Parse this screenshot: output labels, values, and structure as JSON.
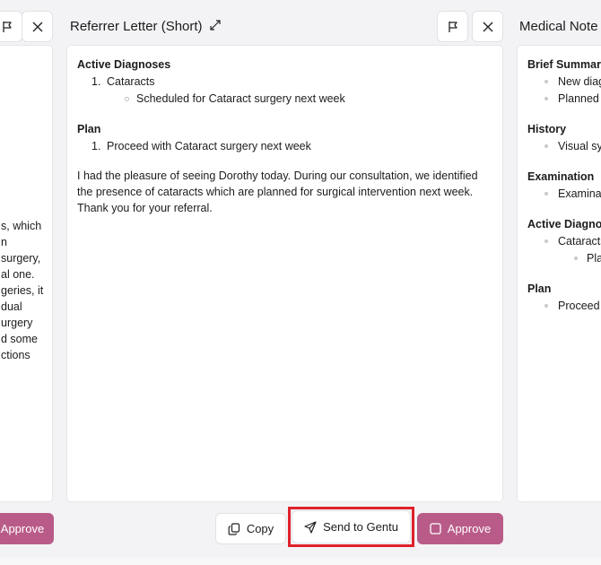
{
  "left_panel": {
    "partial_lines": [
      "s, which",
      "n",
      "surgery,",
      "al one.",
      "geries, it",
      "dual",
      "urgery",
      "d some",
      "ctions"
    ],
    "approve_label": "Approve"
  },
  "center_panel": {
    "title": "Referrer Letter (Short)",
    "sections": {
      "active_diagnoses": {
        "title": "Active Diagnoses",
        "item_number": "1.",
        "item": "Cataracts",
        "subitem": "Scheduled for Cataract surgery next week"
      },
      "plan": {
        "title": "Plan",
        "item_number": "1.",
        "item": "Proceed with Cataract surgery next week"
      }
    },
    "paragraph_lines": [
      "I had the pleasure of seeing Dorothy today. During our consultation, we identified",
      "the presence of cataracts which are planned for surgical intervention next week.",
      "Thank you for your referral."
    ],
    "buttons": {
      "copy": "Copy",
      "send": "Send to Gentu",
      "approve": "Approve"
    }
  },
  "right_panel": {
    "title": "Medical Note",
    "brief_summary": {
      "title": "Brief Summary",
      "items": [
        "New diag",
        "Planned c"
      ]
    },
    "history": {
      "title": "History",
      "items": [
        "Visual syr"
      ]
    },
    "examination": {
      "title": "Examination",
      "items": [
        "Examinati"
      ]
    },
    "active_diagnoses": {
      "title": "Active Diagnos",
      "item": "Cataracts",
      "subitem": "Pla"
    },
    "plan": {
      "title": "Plan",
      "items": [
        "Proceed w"
      ]
    }
  },
  "colors": {
    "approve_button": "#b95b88",
    "highlight": "#e0212b",
    "background": "#f3f3f5"
  },
  "icons": [
    "flag-icon",
    "close-icon",
    "expand-icon",
    "copy-icon",
    "send-icon",
    "checkbox-icon"
  ]
}
